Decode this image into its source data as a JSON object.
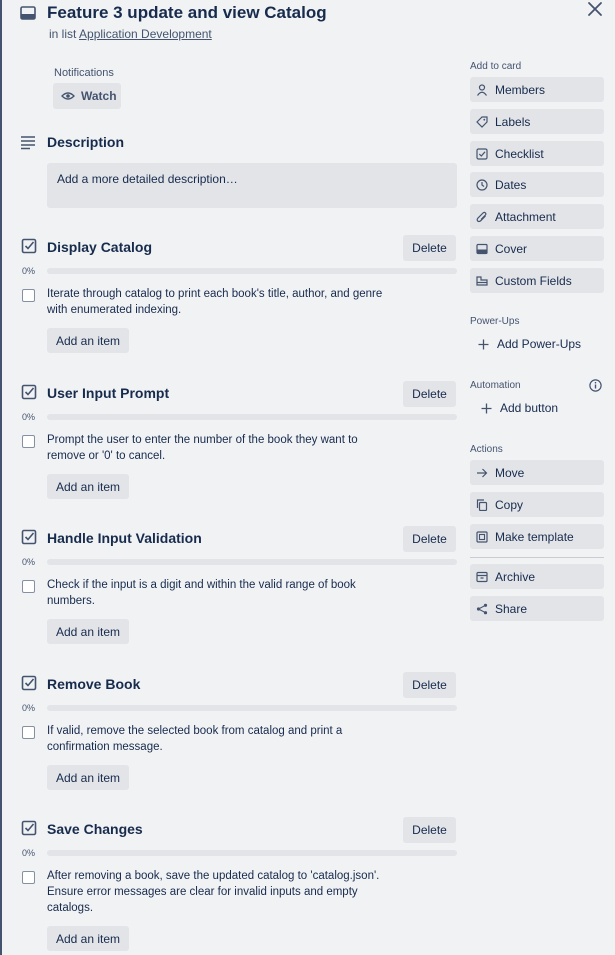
{
  "card": {
    "title": "Feature 3 update and view Catalog",
    "in_list_prefix": "in list",
    "list_name": "Application Development"
  },
  "notifications": {
    "label": "Notifications",
    "watch": "Watch"
  },
  "description": {
    "title": "Description",
    "placeholder": "Add a more detailed description…"
  },
  "checklists": [
    {
      "title": "Display Catalog",
      "delete": "Delete",
      "progress_text": "0%",
      "progress": 0,
      "items": [
        "Iterate through catalog to print each book's title, author, and genre with enumerated indexing."
      ],
      "add_item": "Add an item"
    },
    {
      "title": "User Input Prompt",
      "delete": "Delete",
      "progress_text": "0%",
      "progress": 0,
      "items": [
        "Prompt the user to enter the number of the book they want to remove or '0' to cancel."
      ],
      "add_item": "Add an item"
    },
    {
      "title": "Handle Input Validation",
      "delete": "Delete",
      "progress_text": "0%",
      "progress": 0,
      "items": [
        "Check if the input is a digit and within the valid range of book numbers."
      ],
      "add_item": "Add an item"
    },
    {
      "title": "Remove Book",
      "delete": "Delete",
      "progress_text": "0%",
      "progress": 0,
      "items": [
        "If valid, remove the selected book from catalog and print a confirmation message."
      ],
      "add_item": "Add an item"
    },
    {
      "title": "Save Changes",
      "delete": "Delete",
      "progress_text": "0%",
      "progress": 0,
      "items": [
        "After removing a book, save the updated catalog to 'catalog.json'. Ensure error messages are clear for invalid inputs and empty catalogs."
      ],
      "add_item": "Add an item"
    }
  ],
  "sidebar": {
    "add_to_card_label": "Add to card",
    "add_to_card": [
      {
        "label": "Members",
        "icon": "person-icon"
      },
      {
        "label": "Labels",
        "icon": "tag-icon"
      },
      {
        "label": "Checklist",
        "icon": "checklist-icon"
      },
      {
        "label": "Dates",
        "icon": "clock-icon"
      },
      {
        "label": "Attachment",
        "icon": "paperclip-icon"
      },
      {
        "label": "Cover",
        "icon": "cover-icon"
      },
      {
        "label": "Custom Fields",
        "icon": "custom-fields-icon"
      }
    ],
    "powerups_label": "Power-Ups",
    "add_powerups": "Add Power-Ups",
    "automation_label": "Automation",
    "add_button": "Add button",
    "actions_label": "Actions",
    "actions": [
      {
        "label": "Move",
        "icon": "arrow-right-icon"
      },
      {
        "label": "Copy",
        "icon": "copy-icon"
      },
      {
        "label": "Make template",
        "icon": "template-icon"
      }
    ],
    "actions2": [
      {
        "label": "Archive",
        "icon": "archive-icon"
      },
      {
        "label": "Share",
        "icon": "share-icon"
      }
    ]
  },
  "colors": {
    "background": "#f1f2f4",
    "button": "#e2e4e8",
    "text": "#172b4d",
    "subtle_text": "#44546f"
  }
}
